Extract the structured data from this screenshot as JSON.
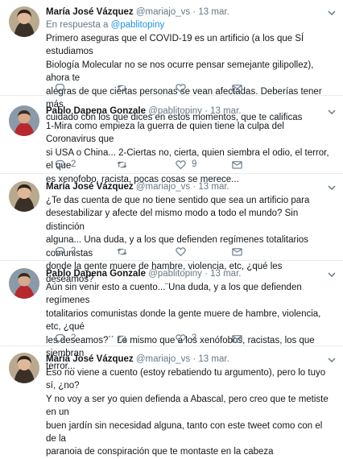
{
  "tweets": [
    {
      "name": "María José Vázquez",
      "handle": "@mariajo_vs",
      "date": "13 mar.",
      "reply_prefix": "En respuesta a",
      "reply_to": "@pablitopiny",
      "text": "Primero aseguras que el COVID-19 es un artificio (a los que SÍ estudiamos\nBiología Molecular no se nos ocurre pensar semejante gilipollez), ahora te\nalegras de que ciertas personas se vean afectadas. Deberías tener más\ncuidado con los que dices en estos momentos, que te calificas",
      "replies": "",
      "retweets": "",
      "likes": ""
    },
    {
      "name": "Pablo Dapena Gonzale",
      "handle": "@pablitopiny",
      "date": "13 mar.",
      "text": "1-Mira como empieza la guerra de quien tiene la culpa del Coronavirus que\nsi USA o China... 2-Ciertas no, cierta, quien siembra el odio, el terror, el que\nes xenofobo, racista, pocas cosas se merece...",
      "replies": "2",
      "retweets": "",
      "likes": "9"
    },
    {
      "name": "María José Vázquez",
      "handle": "@mariajo_vs",
      "date": "13 mar.",
      "text": "¿Te das cuenta de que no tiene sentido que sea un artificio para\ndesestabilizar y afecte del mismo modo a todo el mundo? Sin distinción\nalguna... Una duda, y a los que defienden regímenes totalitarios comunistas\ndonde la gente muere de hambre, violencia, etc, ¿qué les deseamos?",
      "replies": "2",
      "retweets": "",
      "likes": ""
    },
    {
      "name": "Pablo Dapena Gonzale",
      "handle": "@pablitopiny",
      "date": "13 mar.",
      "text": "Aún sin venir esto a cuento...¨Una duda, y a los que defienden regímenes\ntotalitarios comunistas donde la gente muere de hambre, violencia, etc, ¿qué\nles deseamos?´´ Lo mismo que a los xenófobos, racistas, los que siembran\nterror...",
      "replies": "2",
      "retweets": "",
      "likes": "3"
    },
    {
      "name": "María José Vázquez",
      "handle": "@mariajo_vs",
      "date": "13 mar.",
      "text": "Eso no viene a cuento (estoy rebatiendo tu argumento), pero lo tuyo sí, ¿no?\nY no voy a ser yo quien defienda a Abascal, pero creo que te metiste en un\nbuen jardín sin necesidad alguna, tanto con este tweet como con el de la\nparanoia de conspiración que te montaste en la cabeza",
      "replies": "",
      "retweets": "",
      "likes": ""
    }
  ],
  "colors": {
    "link": "#1b95e0",
    "meta": "#657786",
    "divider": "#e6ecf0"
  },
  "icons": [
    "reply-icon",
    "retweet-icon",
    "like-icon",
    "dm-icon",
    "chevron-down-icon"
  ]
}
